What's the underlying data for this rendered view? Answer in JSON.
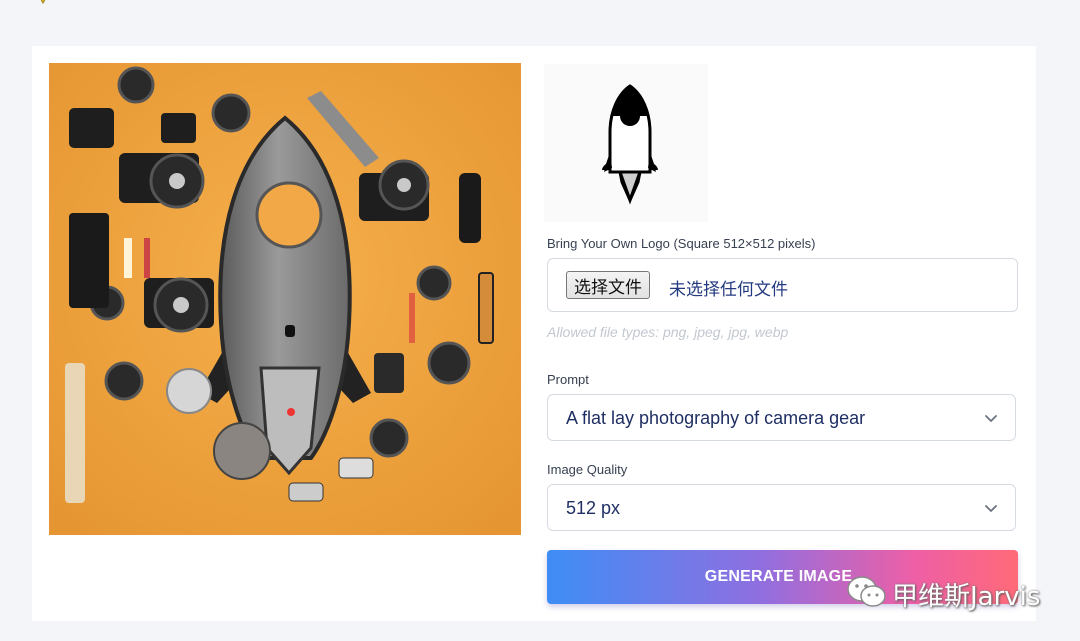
{
  "logo_upload": {
    "label": "Bring Your Own Logo (Square 512×512 pixels)",
    "button_label": "选择文件",
    "status_text": "未选择任何文件",
    "hint": "Allowed file types: png, jpeg, jpg, webp"
  },
  "prompt": {
    "label": "Prompt",
    "value": "A flat lay photography of camera gear"
  },
  "quality": {
    "label": "Image Quality",
    "value": "512 px"
  },
  "generate": {
    "label": "GENERATE IMAGE"
  },
  "watermark": {
    "text": "甲维斯Jarvis"
  },
  "colors": {
    "page_bg": "#f3f5f9",
    "image_bg": "#f0a640",
    "text_dark": "#1f2f63",
    "button_gradient": [
      "#3e8df5",
      "#8f6fe0",
      "#ee5fa6",
      "#ff6a78"
    ]
  }
}
